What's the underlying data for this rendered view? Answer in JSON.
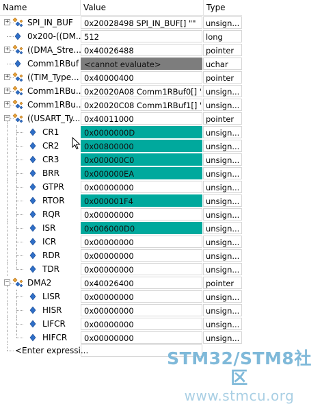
{
  "header": {
    "name": "Name",
    "value": "Value",
    "type": "Type"
  },
  "rows": [
    {
      "name": "SPI_IN_BUF",
      "value": "0x20028498 SPI_IN_BUF[] \"\"",
      "type": "unsign...",
      "level": 0,
      "expander": "+",
      "icon": "struct",
      "state": "normal"
    },
    {
      "name": "0x200-((DM...",
      "value": "512",
      "type": "long",
      "level": 0,
      "expander": "",
      "icon": "var",
      "state": "normal"
    },
    {
      "name": "((DMA_Stre...",
      "value": "0x40026488",
      "type": "pointer",
      "level": 0,
      "expander": "+",
      "icon": "struct",
      "state": "normal"
    },
    {
      "name": "Comm1RBuf",
      "value": "<cannot evaluate>",
      "type": "uchar",
      "level": 0,
      "expander": "",
      "icon": "var",
      "state": "noeval"
    },
    {
      "name": "((TIM_Type...",
      "value": "0x40000400",
      "type": "pointer",
      "level": 0,
      "expander": "+",
      "icon": "struct",
      "state": "normal"
    },
    {
      "name": "Comm1RBu...",
      "value": "0x20020A08 Comm1RBuf0[] \"\"",
      "type": "unsign...",
      "level": 0,
      "expander": "+",
      "icon": "struct",
      "state": "normal"
    },
    {
      "name": "Comm1RBu...",
      "value": "0x20020C08 Comm1RBuf1[] \"\"",
      "type": "unsign...",
      "level": 0,
      "expander": "+",
      "icon": "struct",
      "state": "normal"
    },
    {
      "name": "((USART_Ty...",
      "value": "0x40011000",
      "type": "pointer",
      "level": 0,
      "expander": "-",
      "icon": "struct",
      "state": "normal"
    },
    {
      "name": "CR1",
      "value": "0x0000000D",
      "type": "unsign...",
      "level": 1,
      "expander": "",
      "icon": "var",
      "state": "changed"
    },
    {
      "name": "CR2",
      "value": "0x00800000",
      "type": "unsign...",
      "level": 1,
      "expander": "",
      "icon": "var",
      "state": "changed"
    },
    {
      "name": "CR3",
      "value": "0x000000C0",
      "type": "unsign...",
      "level": 1,
      "expander": "",
      "icon": "var",
      "state": "changed"
    },
    {
      "name": "BRR",
      "value": "0x000000EA",
      "type": "unsign...",
      "level": 1,
      "expander": "",
      "icon": "var",
      "state": "changed"
    },
    {
      "name": "GTPR",
      "value": "0x00000000",
      "type": "unsign...",
      "level": 1,
      "expander": "",
      "icon": "var",
      "state": "normal"
    },
    {
      "name": "RTOR",
      "value": "0x000001F4",
      "type": "unsign...",
      "level": 1,
      "expander": "",
      "icon": "var",
      "state": "changed"
    },
    {
      "name": "RQR",
      "value": "0x00000000",
      "type": "unsign...",
      "level": 1,
      "expander": "",
      "icon": "var",
      "state": "normal"
    },
    {
      "name": "ISR",
      "value": "0x006000D0",
      "type": "unsign...",
      "level": 1,
      "expander": "",
      "icon": "var",
      "state": "changed"
    },
    {
      "name": "ICR",
      "value": "0x00000000",
      "type": "unsign...",
      "level": 1,
      "expander": "",
      "icon": "var",
      "state": "normal"
    },
    {
      "name": "RDR",
      "value": "0x00000000",
      "type": "unsign...",
      "level": 1,
      "expander": "",
      "icon": "var",
      "state": "normal"
    },
    {
      "name": "TDR",
      "value": "0x00000000",
      "type": "unsign...",
      "level": 1,
      "expander": "",
      "icon": "var",
      "state": "normal"
    },
    {
      "name": "DMA2",
      "value": "0x40026400",
      "type": "pointer",
      "level": 0,
      "expander": "-",
      "icon": "struct",
      "state": "normal"
    },
    {
      "name": "LISR",
      "value": "0x00000000",
      "type": "unsign...",
      "level": 1,
      "expander": "",
      "icon": "var",
      "state": "normal"
    },
    {
      "name": "HISR",
      "value": "0x00000000",
      "type": "unsign...",
      "level": 1,
      "expander": "",
      "icon": "var",
      "state": "normal"
    },
    {
      "name": "LIFCR",
      "value": "0x00000000",
      "type": "unsign...",
      "level": 1,
      "expander": "",
      "icon": "var",
      "state": "normal"
    },
    {
      "name": "HIFCR",
      "value": "0x00000000",
      "type": "unsign...",
      "level": 1,
      "expander": "",
      "icon": "var",
      "state": "normal"
    }
  ],
  "enter_row": {
    "label": "<Enter expressi..."
  },
  "watermark": {
    "title": "STM32/STM8社区",
    "url": "www.stmcu.org"
  },
  "colors": {
    "changed": "#00a99d",
    "noeval": "#7d7d7d",
    "icon_blue": "#2f6fc8",
    "icon_orange": "#e8a23a"
  }
}
